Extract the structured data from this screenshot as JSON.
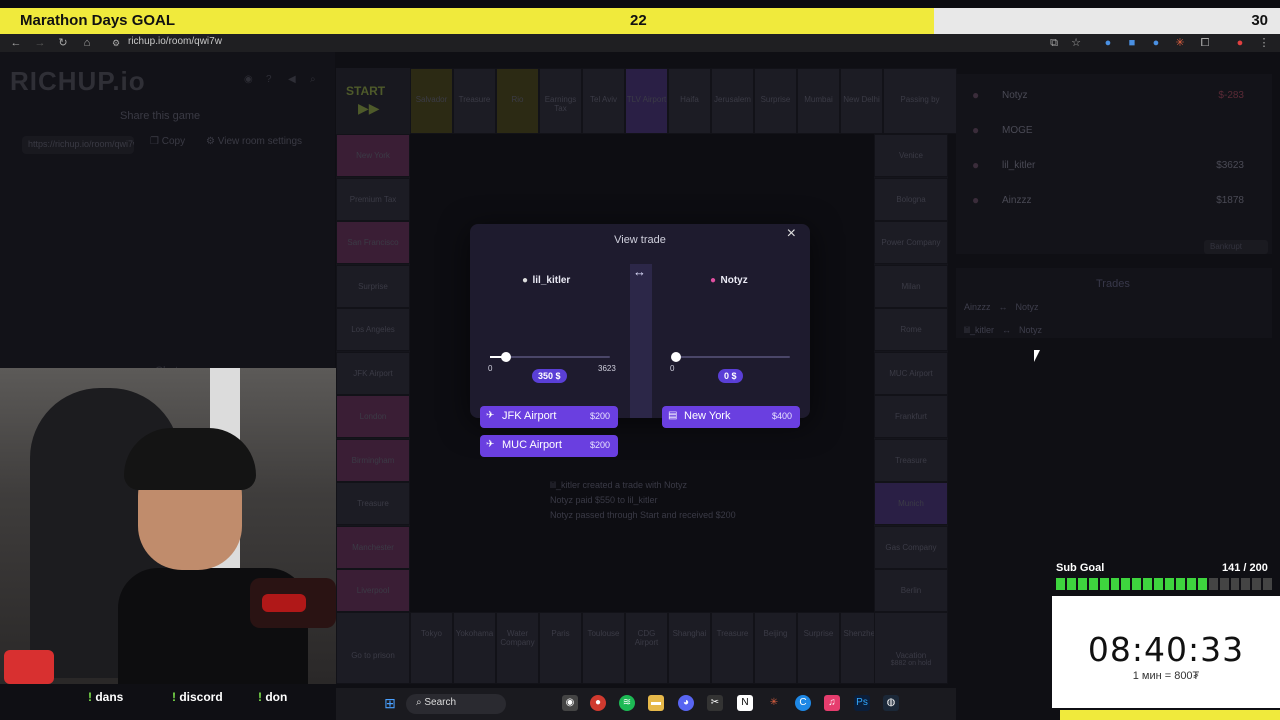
{
  "goal": {
    "title": "Marathon Days GOAL",
    "current": "22",
    "target": "30",
    "fill_fraction": 0.73
  },
  "browser": {
    "url": "richup.io/room/qwi7w"
  },
  "left_panel": {
    "logo": "RICHUP.io",
    "share_title": "Share this game",
    "share_url": "https://richup.io/room/qwi7w",
    "copy_label": "Copy",
    "room_settings_label": "View room settings",
    "chat_label": "Chat"
  },
  "board": {
    "top_tiles": [
      "Salvador",
      "Treasure",
      "Rio",
      "Earnings Tax",
      "Tel Aviv",
      "TLV Airport",
      "Haifa",
      "Jerusalem",
      "Surprise",
      "Mumbai",
      "New Delhi",
      "Passing by"
    ],
    "bottom_tiles": [
      "Go to prison",
      "Tokyo",
      "Yokohama",
      "Water Company",
      "Paris",
      "Toulouse",
      "CDG Airport",
      "Shanghai",
      "Treasure",
      "Beijing",
      "Surprise",
      "Shenzhen",
      "Vacation"
    ],
    "left_tiles": [
      "New York",
      "Premium Tax",
      "San Francisco",
      "Surprise",
      "Los Angeles",
      "JFK Airport",
      "London",
      "Birmingham",
      "Treasure",
      "Manchester",
      "Liverpool"
    ],
    "right_tiles": [
      "Venice",
      "Bologna",
      "Power Company",
      "Milan",
      "Rome",
      "MUC Airport",
      "Frankfurt",
      "Treasure",
      "Munich",
      "Gas Company",
      "Berlin"
    ],
    "start_label": "START",
    "vacation_sub": "$882 on hold",
    "log": [
      "lil_kitler created a trade with Notyz",
      "Notyz paid $550 to lil_kitler",
      "Notyz passed through Start and received $200"
    ]
  },
  "trade_modal": {
    "title": "View trade",
    "close_icon": "close-icon",
    "left_player": "lil_kitler",
    "right_player": "Notyz",
    "left_slider": {
      "min": "0",
      "max": "3623",
      "value_label": "350 $",
      "fraction": 0.1
    },
    "right_slider": {
      "min": "0",
      "value_label": "0 $",
      "fraction": 0
    },
    "left_properties": [
      {
        "name": "JFK Airport",
        "price": "$200",
        "icon": "plane-icon"
      },
      {
        "name": "MUC Airport",
        "price": "$200",
        "icon": "plane-icon"
      }
    ],
    "right_properties": [
      {
        "name": "New York",
        "price": "$400",
        "icon": "us-flag-icon"
      }
    ]
  },
  "players": [
    {
      "name": "Notyz",
      "money": "$-283"
    },
    {
      "name": "MOGE",
      "money": ""
    },
    {
      "name": "lil_kitler",
      "money": "$3623"
    },
    {
      "name": "Ainzzz",
      "money": "$1878"
    }
  ],
  "bankrupt_label": "Bankrupt",
  "trades_panel": {
    "title": "Trades",
    "rows": [
      {
        "from": "Ainzzz",
        "to": "Notyz"
      },
      {
        "from": "lil_kitler",
        "to": "Notyz"
      }
    ]
  },
  "stream_commands": [
    {
      "text": "dans"
    },
    {
      "text": "discord"
    },
    {
      "text": "don"
    }
  ],
  "taskbar": {
    "search_placeholder": "Search"
  },
  "sub_goal": {
    "label": "Sub Goal",
    "count": "141 / 200",
    "fraction": 0.705
  },
  "timer": {
    "time": "08:40:33",
    "rate": "1 мин = 800₮"
  }
}
